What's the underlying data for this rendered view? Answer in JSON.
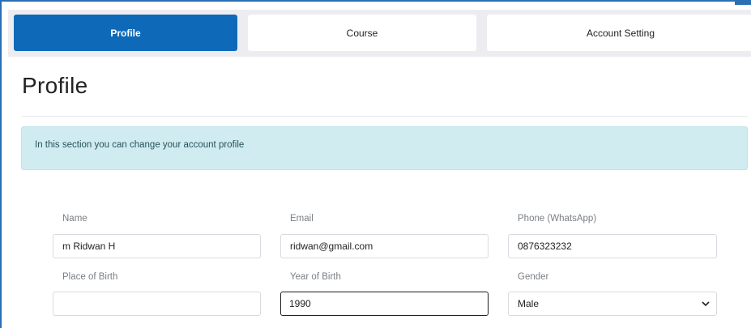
{
  "tabs": [
    {
      "label": "Profile",
      "active": true
    },
    {
      "label": "Course",
      "active": false
    },
    {
      "label": "Account Setting",
      "active": false
    }
  ],
  "page": {
    "title": "Profile",
    "notice": "In this section you can change your account profile"
  },
  "form": {
    "name": {
      "label": "Name",
      "value": "m Ridwan H"
    },
    "email": {
      "label": "Email",
      "value": "ridwan@gmail.com"
    },
    "phone": {
      "label": "Phone (WhatsApp)",
      "value": "0876323232"
    },
    "place_of_birth": {
      "label": "Place of Birth",
      "value": ""
    },
    "year_of_birth": {
      "label": "Year of Birth",
      "value": "1990"
    },
    "gender": {
      "label": "Gender",
      "value": "Male"
    }
  },
  "colors": {
    "accent": "#0e6ab8",
    "alert_bg": "#d1ecf0"
  },
  "icons": {
    "gender_dropdown": "chevron-down-icon"
  }
}
